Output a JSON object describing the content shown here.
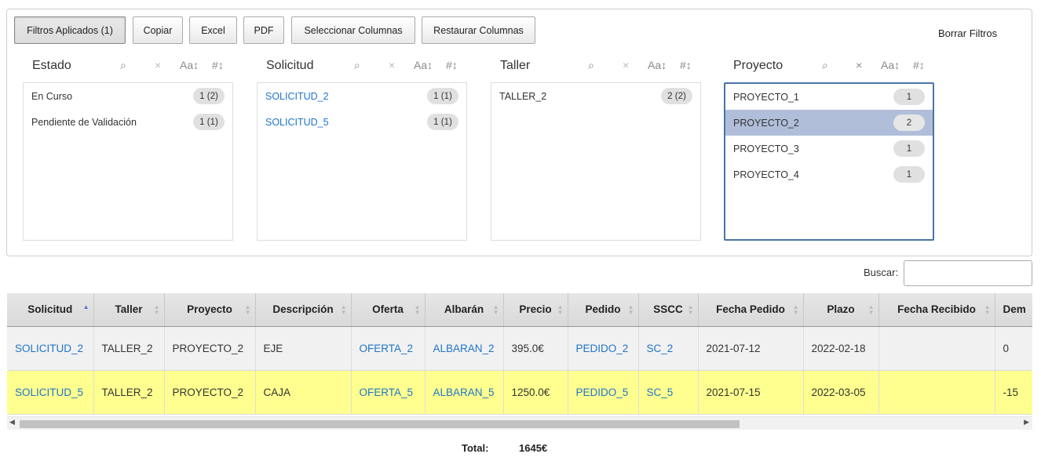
{
  "toolbar": {
    "filters_applied": "Filtros Aplicados (1)",
    "copy": "Copiar",
    "excel": "Excel",
    "pdf": "PDF",
    "select_columns": "Seleccionar Columnas",
    "restore_columns": "Restaurar Columnas",
    "clear_filters": "Borrar Filtros"
  },
  "pane_controls": {
    "search": "⌕",
    "clear": "×",
    "sort_alpha": "Aa↕",
    "sort_count": "#↕"
  },
  "panes": [
    {
      "title": "Estado",
      "rows": [
        {
          "label": "En Curso",
          "count": "1 (2)"
        },
        {
          "label": "Pendiente de Validación",
          "count": "1 (1)"
        }
      ]
    },
    {
      "title": "Solicitud",
      "rows": [
        {
          "label": "SOLICITUD_2",
          "count": "1 (1)"
        },
        {
          "label": "SOLICITUD_5",
          "count": "1 (1)"
        }
      ]
    },
    {
      "title": "Taller",
      "rows": [
        {
          "label": "TALLER_2",
          "count": "2 (2)"
        }
      ]
    },
    {
      "title": "Proyecto",
      "rows": [
        {
          "label": "PROYECTO_1",
          "count": "1"
        },
        {
          "label": "PROYECTO_2",
          "count": "2"
        },
        {
          "label": "PROYECTO_3",
          "count": "1"
        },
        {
          "label": "PROYECTO_4",
          "count": "1"
        }
      ]
    }
  ],
  "search": {
    "label": "Buscar:",
    "value": ""
  },
  "table": {
    "columns": [
      "Solicitud",
      "Taller",
      "Proyecto",
      "Descripción",
      "Oferta",
      "Albarán",
      "Precio",
      "Pedido",
      "SSCC",
      "Fecha Pedido",
      "Plazo",
      "Fecha Recibido",
      "Dem"
    ],
    "rows": [
      [
        "SOLICITUD_2",
        "TALLER_2",
        "PROYECTO_2",
        "EJE",
        "OFERTA_2",
        "ALBARAN_2",
        "395.0€",
        "PEDIDO_2",
        "SC_2",
        "2021-07-12",
        "2022-02-18",
        "",
        "0"
      ],
      [
        "SOLICITUD_5",
        "TALLER_2",
        "PROYECTO_2",
        "CAJA",
        "OFERTA_5",
        "ALBARAN_5",
        "1250.0€",
        "PEDIDO_5",
        "SC_5",
        "2021-07-15",
        "2022-03-05",
        "",
        "-15"
      ]
    ]
  },
  "footer": {
    "total_label": "Total:",
    "total_value": "1645€"
  },
  "colors": {
    "link": "#1f74c9",
    "selected_row": "#b0bed9",
    "highlight_row": "#ffff8f",
    "focus_border": "#4a74a8"
  }
}
